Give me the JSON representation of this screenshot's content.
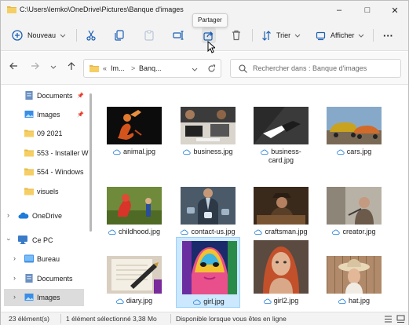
{
  "window": {
    "title": "C:\\Users\\lemko\\OneDrive\\Pictures\\Banque d'images",
    "controls": {
      "minimize": "–",
      "maximize": "□",
      "close": "✕"
    }
  },
  "toolbar": {
    "new_label": "Nouveau",
    "sort_label": "Trier",
    "view_label": "Afficher",
    "more_label": "···",
    "tooltip": "Partager",
    "icons": [
      "cut-icon",
      "copy-icon",
      "paste-icon",
      "rename-icon",
      "share-icon",
      "delete-icon"
    ]
  },
  "address": {
    "prefix": "«",
    "segments": [
      "Im...",
      "Banq..."
    ],
    "separator": ">",
    "search_placeholder": "Rechercher dans : Banque d'images"
  },
  "sidebar": {
    "items": [
      {
        "label": "Documents",
        "icon": "documents-icon",
        "pinned": true
      },
      {
        "label": "Images",
        "icon": "images-icon",
        "pinned": true
      },
      {
        "label": "09 2021",
        "icon": "folder-icon",
        "pinned": false
      },
      {
        "label": "553 - Installer W",
        "icon": "folder-icon",
        "pinned": false
      },
      {
        "label": "554 - Windows",
        "icon": "folder-icon",
        "pinned": false
      },
      {
        "label": "visuels",
        "icon": "folder-icon",
        "pinned": false
      },
      {
        "label": "OneDrive",
        "icon": "onedrive-icon",
        "expandable": true
      },
      {
        "label": "Ce PC",
        "icon": "pc-icon",
        "expandable": true,
        "expanded": true
      },
      {
        "label": "Bureau",
        "icon": "desktop-icon",
        "expandable": true
      },
      {
        "label": "Documents",
        "icon": "documents-icon",
        "expandable": true
      },
      {
        "label": "Images",
        "icon": "images-icon",
        "expandable": true,
        "selected": true
      }
    ]
  },
  "files": [
    {
      "name": "animal.jpg",
      "thumb": "animal"
    },
    {
      "name": "business.jpg",
      "thumb": "business"
    },
    {
      "name": "business-card.jpg",
      "thumb": "business-card"
    },
    {
      "name": "cars.jpg",
      "thumb": "cars"
    },
    {
      "name": "childhood.jpg",
      "thumb": "childhood"
    },
    {
      "name": "contact-us.jpg",
      "thumb": "contact-us"
    },
    {
      "name": "craftsman.jpg",
      "thumb": "craftsman"
    },
    {
      "name": "creator.jpg",
      "thumb": "creator"
    },
    {
      "name": "diary.jpg",
      "thumb": "diary"
    },
    {
      "name": "girl.jpg",
      "thumb": "girl",
      "selected": true
    },
    {
      "name": "girl2.jpg",
      "thumb": "girl2"
    },
    {
      "name": "hat.jpg",
      "thumb": "hat"
    }
  ],
  "status": {
    "count": "23 élément(s)",
    "selected": "1 élément sélectionné  3,38 Mo",
    "availability": "Disponible lorsque vous êtes en ligne"
  }
}
